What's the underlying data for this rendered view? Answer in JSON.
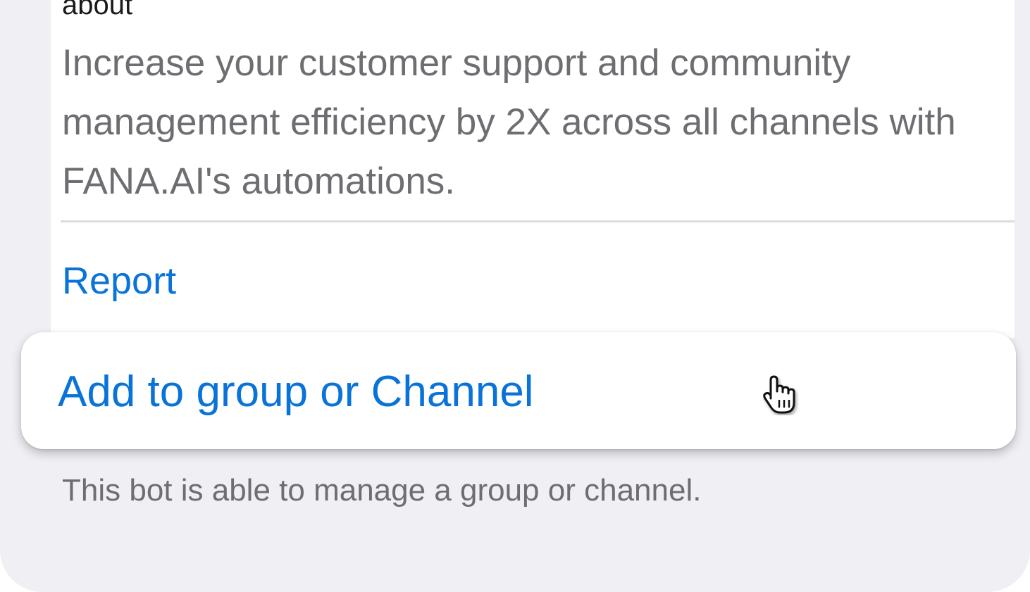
{
  "about": {
    "label": "about",
    "text": "Increase your customer support and community management efficiency by 2X across all channels with FANA.AI's automations."
  },
  "actions": {
    "report_label": "Report",
    "add_label": "Add to group or Channel"
  },
  "footer": {
    "note": "This bot is able to manage a group or channel."
  },
  "icons": {
    "cursor": "hand-pointer-icon"
  },
  "colors": {
    "link": "#0a73d9",
    "secondary_text": "#6d6d72",
    "background": "#efeff4"
  }
}
